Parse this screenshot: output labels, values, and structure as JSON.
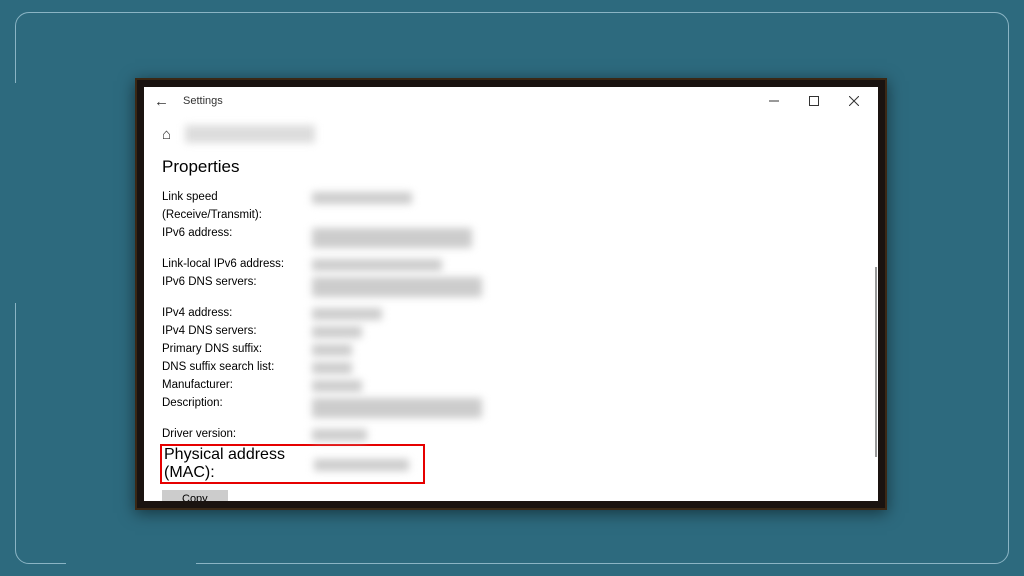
{
  "titlebar": {
    "app_title": "Settings"
  },
  "section": {
    "title": "Properties"
  },
  "properties": {
    "link_speed": "Link speed (Receive/Transmit):",
    "ipv6_address": "IPv6 address:",
    "link_local_ipv6": "Link-local IPv6 address:",
    "ipv6_dns": "IPv6 DNS servers:",
    "ipv4_address": "IPv4 address:",
    "ipv4_dns": "IPv4 DNS servers:",
    "primary_dns_suffix": "Primary DNS suffix:",
    "dns_suffix_search": "DNS suffix search list:",
    "manufacturer": "Manufacturer:",
    "description": "Description:",
    "driver_version": "Driver version:",
    "physical_address": "Physical address (MAC):"
  },
  "buttons": {
    "copy": "Copy"
  }
}
